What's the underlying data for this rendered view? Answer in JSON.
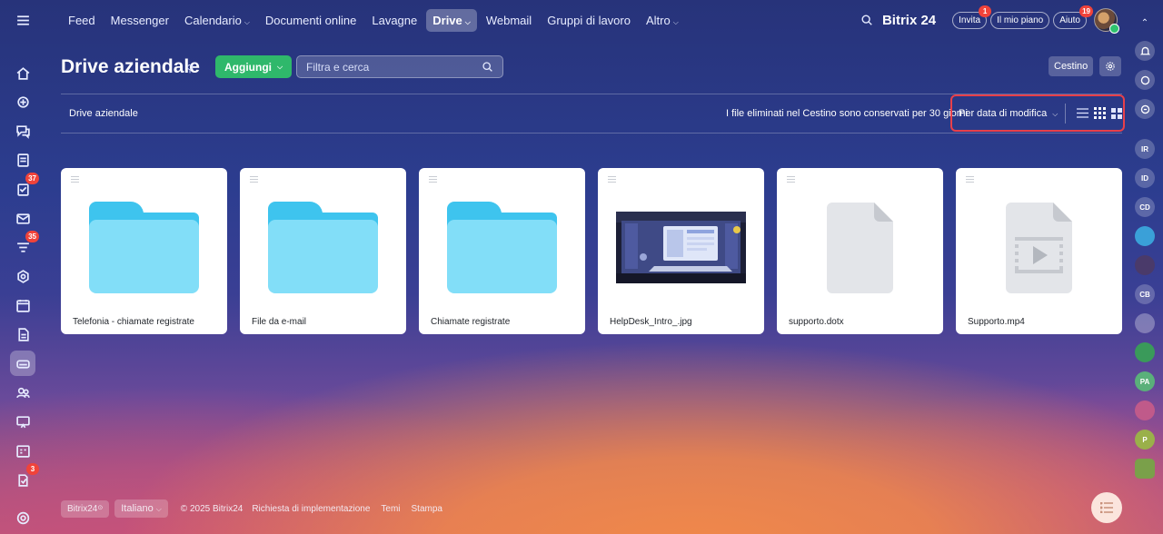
{
  "nav": {
    "items": [
      {
        "label": "Feed",
        "caret": false,
        "active": false
      },
      {
        "label": "Messenger",
        "caret": false,
        "active": false
      },
      {
        "label": "Calendario",
        "caret": true,
        "active": false
      },
      {
        "label": "Documenti online",
        "caret": false,
        "active": false
      },
      {
        "label": "Lavagne",
        "caret": false,
        "active": false
      },
      {
        "label": "Drive",
        "caret": true,
        "active": true
      },
      {
        "label": "Webmail",
        "caret": false,
        "active": false
      },
      {
        "label": "Gruppi di lavoro",
        "caret": false,
        "active": false
      },
      {
        "label": "Altro",
        "caret": true,
        "active": false
      }
    ],
    "brand": "Bitrix 24",
    "invite_label": "Invita",
    "invite_badge": "1",
    "plan_label": "Il mio piano",
    "help_label": "Aiuto",
    "help_badge": "19"
  },
  "left_sidebar": {
    "badges": {
      "tasks": "37",
      "feed": "35",
      "workflow": "3"
    }
  },
  "right_sidebar": {
    "avatars": [
      "IR",
      "ID",
      "CD",
      "",
      "",
      "CB",
      "",
      "",
      "PA",
      "",
      "P",
      ""
    ]
  },
  "header": {
    "title": "Drive aziendale",
    "add_button": "Aggiungi",
    "search_placeholder": "Filtra e cerca",
    "trash_button": "Cestino"
  },
  "toolbar": {
    "breadcrumb": "Drive aziendale",
    "trash_note": "I file eliminati nel Cestino sono conservati per 30 giorni",
    "sort_label": "Per data di modifica"
  },
  "files": [
    {
      "name": "Telefonia - chiamate registrate",
      "type": "folder"
    },
    {
      "name": "File da e-mail",
      "type": "folder"
    },
    {
      "name": "Chiamate registrate",
      "type": "folder"
    },
    {
      "name": "HelpDesk_Intro_.jpg",
      "type": "image"
    },
    {
      "name": "supporto.dotx",
      "type": "doc"
    },
    {
      "name": "Supporto.mp4",
      "type": "video"
    }
  ],
  "footer": {
    "brand": "Bitrix24",
    "language": "Italiano",
    "copyright": "© 2025 Bitrix24",
    "links": [
      "Richiesta di implementazione",
      "Temi",
      "Stampa"
    ]
  },
  "colors": {
    "accent_green": "#2fb86b",
    "badge_red": "#f0433a",
    "highlight_red": "#e8404a",
    "folder_blue": "#82def8"
  }
}
